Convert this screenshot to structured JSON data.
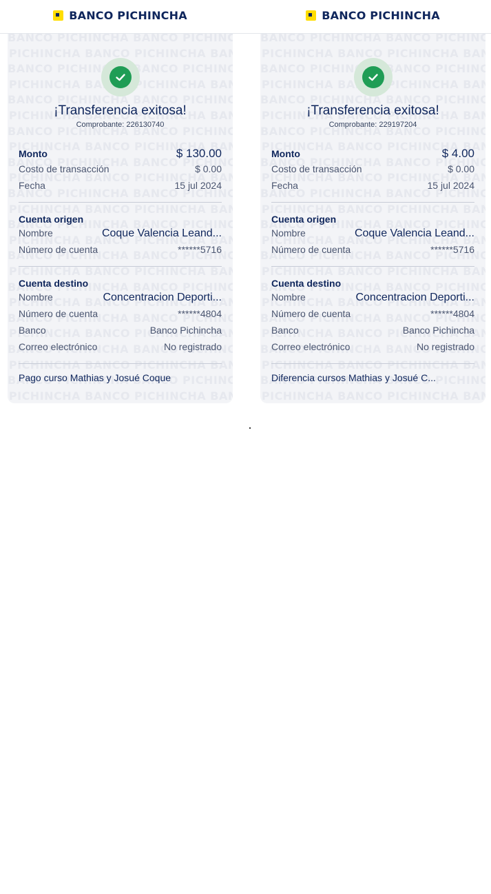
{
  "brand": {
    "name": "BANCO PICHINCHA",
    "watermark_text": "BANCO PICHINCHA",
    "colors": {
      "primary": "#0f265c",
      "accent_yellow": "#ffdd00",
      "success": "#1f9d55"
    }
  },
  "receipts": [
    {
      "title": "¡Transferencia exitosa!",
      "voucher": "Comprobante: 226130740",
      "summary": {
        "monto_label": "Monto",
        "monto_value": "$ 130.00",
        "costo_label": "Costo de transacción",
        "costo_value": "$ 0.00",
        "fecha_label": "Fecha",
        "fecha_value": "15 jul 2024"
      },
      "origen": {
        "section_label": "Cuenta origen",
        "nombre_label": "Nombre",
        "nombre_value": "Coque  Valencia Leand...",
        "cuenta_label": "Número de cuenta",
        "cuenta_value": "******5716"
      },
      "destino": {
        "section_label": "Cuenta destino",
        "nombre_label": "Nombre",
        "nombre_value": "Concentracion Deporti...",
        "cuenta_label": "Número de cuenta",
        "cuenta_value": "******4804",
        "banco_label": "Banco",
        "banco_value": "Banco Pichincha",
        "correo_label": "Correo electrónico",
        "correo_value": "No registrado"
      },
      "note": "Pago curso Mathias y Josué Coque"
    },
    {
      "title": "¡Transferencia exitosa!",
      "voucher": "Comprobante: 229197204",
      "summary": {
        "monto_label": "Monto",
        "monto_value": "$ 4.00",
        "costo_label": "Costo de transacción",
        "costo_value": "$ 0.00",
        "fecha_label": "Fecha",
        "fecha_value": "15 jul 2024"
      },
      "origen": {
        "section_label": "Cuenta origen",
        "nombre_label": "Nombre",
        "nombre_value": "Coque  Valencia Leand...",
        "cuenta_label": "Número de cuenta",
        "cuenta_value": "******5716"
      },
      "destino": {
        "section_label": "Cuenta destino",
        "nombre_label": "Nombre",
        "nombre_value": "Concentracion Deporti...",
        "cuenta_label": "Número de cuenta",
        "cuenta_value": "******4804",
        "banco_label": "Banco",
        "banco_value": "Banco Pichincha",
        "correo_label": "Correo electrónico",
        "correo_value": "No registrado"
      },
      "note": "Diferencia cursos Mathias y Josué C..."
    }
  ]
}
